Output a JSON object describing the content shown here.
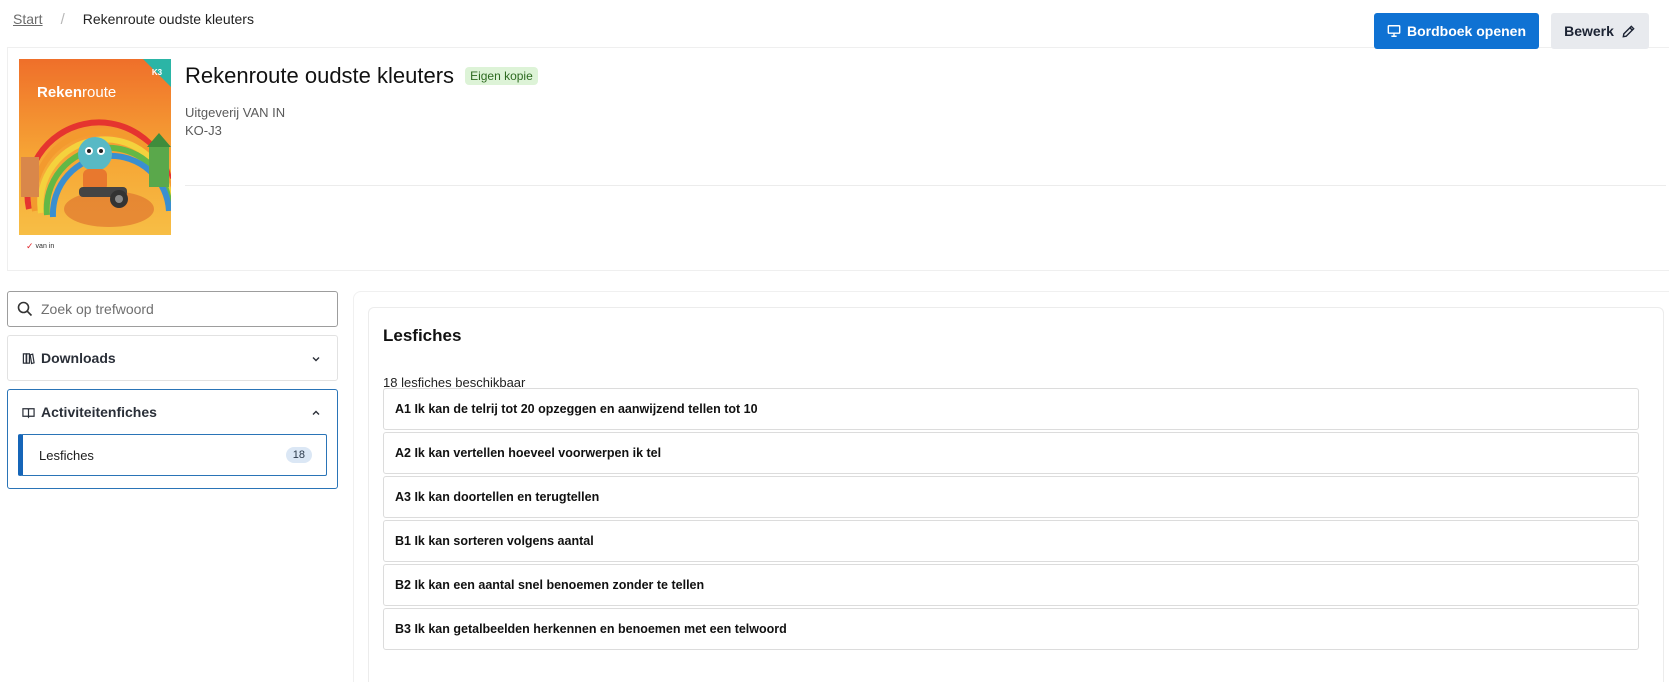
{
  "breadcrumb": {
    "home": "Start",
    "separator": "/",
    "current": "Rekenroute oudste kleuters"
  },
  "book": {
    "title": "Rekenroute oudste kleuters",
    "badge": "Eigen kopie",
    "publisher": "Uitgeverij VAN IN",
    "level": "KO-J3",
    "cover": {
      "brand_prefix": "Reken",
      "brand_suffix": "route",
      "corner_tag": "K3",
      "publisher_mark": "van in",
      "colors": {
        "sky": "#f39a2e",
        "ground": "#f6b53a",
        "brand_text": "#ffffff",
        "corner": "#2bb5a6"
      }
    }
  },
  "actions": {
    "open_board": "Bordboek openen",
    "edit": "Bewerk"
  },
  "sidebar": {
    "search_placeholder": "Zoek op trefwoord",
    "sections": [
      {
        "label": "Downloads",
        "icon": "books-icon",
        "expanded": false
      },
      {
        "label": "Activiteitenfiches",
        "icon": "book-open-icon",
        "expanded": true,
        "items": [
          {
            "label": "Lesfiches",
            "count": "18"
          }
        ]
      }
    ]
  },
  "main": {
    "title": "Lesfiches",
    "count_text": "18 lesfiches beschikbaar",
    "items": [
      "A1 Ik kan de telrij tot 20 opzeggen en aanwijzend tellen tot 10",
      "A2 Ik kan vertellen hoeveel voorwerpen ik tel",
      "A3 Ik kan doortellen en terugtellen",
      "B1 Ik kan sorteren volgens aantal",
      "B2 Ik kan een aantal snel benoemen zonder te tellen",
      "B3 Ik kan getalbeelden herkennen en benoemen met een telwoord"
    ]
  },
  "colors": {
    "primary": "#0f72d3",
    "secondary_bg": "#e8eaee",
    "badge_bg": "#ddf3d7",
    "badge_text": "#2d6a20",
    "active_border": "#2a74b7"
  }
}
